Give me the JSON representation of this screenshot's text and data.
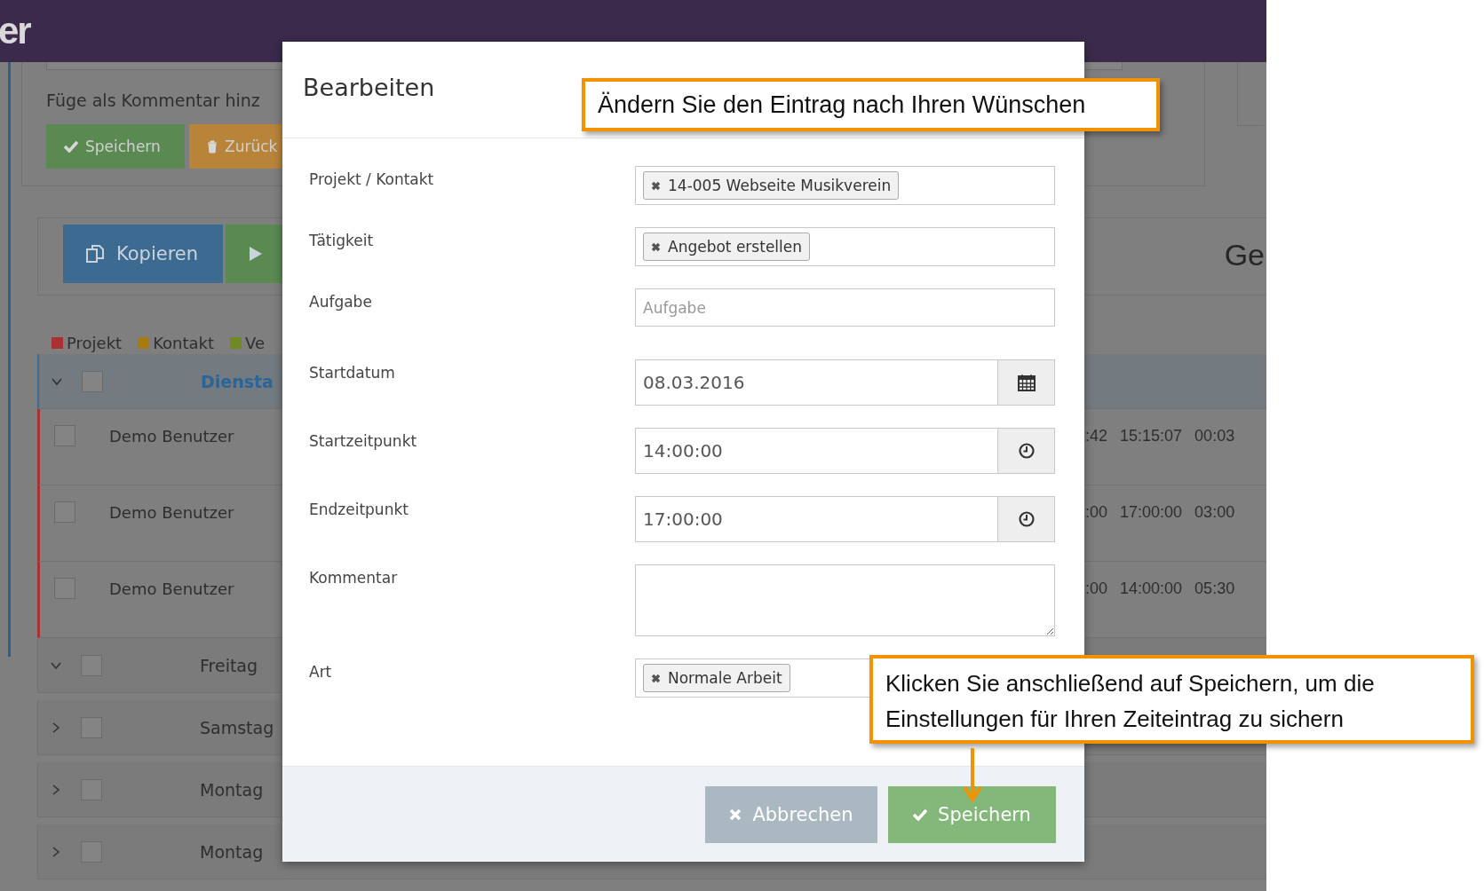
{
  "app_header": {
    "logo_text": "er"
  },
  "comment_panel": {
    "hint": "Füge als Kommentar hinz",
    "buttons": [
      {
        "kind": "save",
        "label": "Speichern"
      },
      {
        "kind": "back",
        "label": "Zurück"
      }
    ]
  },
  "toolbar": {
    "buttons": [
      {
        "kind": "copy",
        "label": "Kopieren"
      },
      {
        "kind": "play"
      }
    ],
    "heading": "Ge"
  },
  "legend": [
    {
      "label": "Projekt",
      "color": "#a83232"
    },
    {
      "label": "Kontakt",
      "color": "#a57c12"
    },
    {
      "label": "Ve",
      "color": "#6f8a22"
    }
  ],
  "table": {
    "groups": [
      {
        "label": "Diensta",
        "expanded": true,
        "selected": true,
        "checked": false,
        "rows": [
          {
            "name": "Demo Benutzer",
            "checked": false,
            "column_2": ":42",
            "column_3": "15:15:07",
            "column_4": "00:03"
          },
          {
            "name": "Demo Benutzer",
            "checked": false,
            "column_2": ":00",
            "column_3": "17:00:00",
            "column_4": "03:00"
          },
          {
            "name": "Demo Benutzer",
            "checked": false,
            "column_2": ":00",
            "column_3": "14:00:00",
            "column_4": "05:30"
          }
        ]
      },
      {
        "label": "Freitag",
        "expanded": true,
        "selected": false,
        "checked": false
      },
      {
        "label": "Samstag",
        "expanded": false,
        "selected": false,
        "checked": false
      },
      {
        "label": "Montag",
        "expanded": false,
        "selected": false,
        "checked": false
      },
      {
        "label": "Montag",
        "expanded": false,
        "selected": false,
        "checked": false
      }
    ]
  },
  "modal": {
    "title": "Bearbeiten",
    "fields": [
      {
        "kind": "tag",
        "label": "Projekt / Kontakt",
        "value": "14-005 Webseite Musikverein"
      },
      {
        "kind": "tag",
        "label": "Tätigkeit",
        "value": "Angebot erstellen"
      },
      {
        "kind": "text",
        "label": "Aufgabe",
        "placeholder": "Aufgabe"
      },
      {
        "kind": "date",
        "label": "Startdatum",
        "value": "08.03.2016"
      },
      {
        "kind": "time",
        "label": "Startzeitpunkt",
        "value": "14:00:00"
      },
      {
        "kind": "time",
        "label": "Endzeitpunkt",
        "value": "17:00:00"
      },
      {
        "kind": "textarea",
        "label": "Kommentar"
      },
      {
        "kind": "tag",
        "label": "Art",
        "value": "Normale Arbeit"
      }
    ],
    "buttons": [
      {
        "kind": "cancel",
        "label": "Abbrechen"
      },
      {
        "kind": "save",
        "label": "Speichern"
      }
    ]
  },
  "callouts": [
    {
      "text": "Ändern Sie den Eintrag nach Ihren Wünschen",
      "arrow": false
    },
    {
      "text": "Klicken Sie anschließend auf Speichern, um die Einstellungen für Ihren Zeiteintrag zu sichern",
      "arrow": true
    }
  ]
}
